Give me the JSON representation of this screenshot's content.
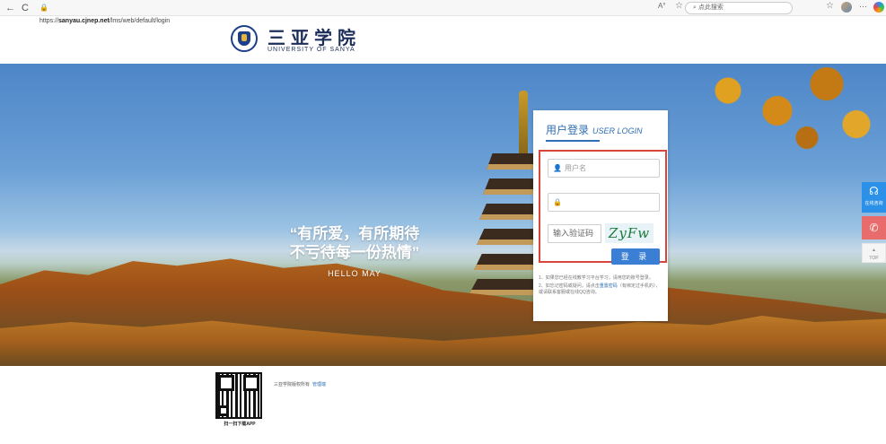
{
  "browser": {
    "back": "←",
    "refresh": "C",
    "url_prefix": "https://",
    "url_host": "sanyau.cjnep.net",
    "url_path": "/lms/web/default/login",
    "search_placeholder": "点此搜索"
  },
  "header": {
    "school_name_cn": "三亚学院",
    "school_name_en": "UNIVERSITY OF SANYA"
  },
  "banner": {
    "slogan_line1": "“有所爱，有所期待",
    "slogan_line2": "不亏待每一份热情”",
    "slogan_line3": "HELLO MAY"
  },
  "login": {
    "title_cn": "用户登录",
    "title_en": "USER LOGIN",
    "username_placeholder": "用户名",
    "password_placeholder": "",
    "captcha_placeholder": "输入验证码",
    "captcha_text": "ZyFw",
    "submit_label": "登 录",
    "note1": "1、如果您已经在线教学习平台学习，请用您的账号登录。",
    "note2_prefix": "2、如忘记密码或疑问，请点击",
    "note2_link": "重置密码",
    "note2_suffix": "（有绑定过手机的），或请联系客服或在线QQ咨询。"
  },
  "side_tools": {
    "service_label": "在线咨询",
    "top_label": "TOP"
  },
  "footer": {
    "qr_label": "扫一扫下载APP",
    "copyright": "三亚学院版权所有",
    "admin_link": "管理端"
  },
  "colors": {
    "accent": "#2f6fb3",
    "button": "#3a7fd4",
    "highlight_border": "#d9453c"
  }
}
